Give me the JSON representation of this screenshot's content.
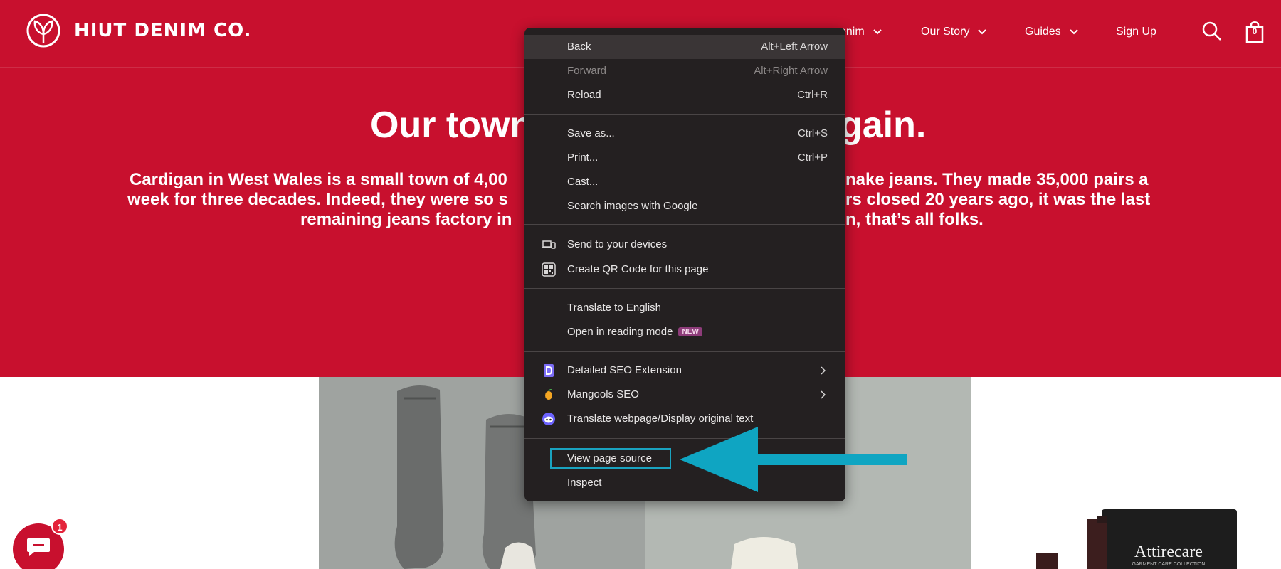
{
  "brand": {
    "name": "HIUT DENIM CO.",
    "red": "#c8102e"
  },
  "nav": {
    "items": [
      {
        "label": "enim",
        "icon": "chevron-down-icon"
      },
      {
        "label": "Our Story",
        "icon": "chevron-down-icon"
      },
      {
        "label": "Guides",
        "icon": "chevron-down-icon"
      },
      {
        "label": "Sign Up"
      }
    ],
    "cart_count": "0"
  },
  "hero": {
    "title_left": "Our town",
    "title_right": "gain.",
    "line1_left": "Cardigan in West Wales is a small town of 4,00",
    "line1_right": "nake jeans. They made 35,000 pairs a",
    "line2_left": "week for three decades. Indeed, they were so s",
    "line2_right": "rs closed 20 years ago, it was the last",
    "line3_left": "remaining jeans factory in",
    "line3_right": "n, that’s all folks."
  },
  "products": {
    "brand_box": "Attirecare",
    "brand_box_sub": "GARMENT CARE COLLECTION"
  },
  "chat": {
    "badge": "1"
  },
  "context_menu": {
    "back": {
      "label": "Back",
      "shortcut": "Alt+Left Arrow"
    },
    "forward": {
      "label": "Forward",
      "shortcut": "Alt+Right Arrow"
    },
    "reload": {
      "label": "Reload",
      "shortcut": "Ctrl+R"
    },
    "save_as": {
      "label": "Save as...",
      "shortcut": "Ctrl+S"
    },
    "print": {
      "label": "Print...",
      "shortcut": "Ctrl+P"
    },
    "cast": {
      "label": "Cast..."
    },
    "search_images": {
      "label": "Search images with Google"
    },
    "send_devices": {
      "label": "Send to your devices"
    },
    "qr_code": {
      "label": "Create QR Code for this page"
    },
    "translate_en": {
      "label": "Translate to English"
    },
    "reading_mode": {
      "label": "Open in reading mode",
      "badge": "NEW"
    },
    "detailed_seo": {
      "label": "Detailed SEO Extension"
    },
    "mangools": {
      "label": "Mangools SEO"
    },
    "translate_webpage": {
      "label": "Translate webpage/Display original text"
    },
    "view_source": {
      "label": "View page source"
    },
    "inspect": {
      "label": "Inspect"
    },
    "highlight_color": "#1aa3c0"
  }
}
